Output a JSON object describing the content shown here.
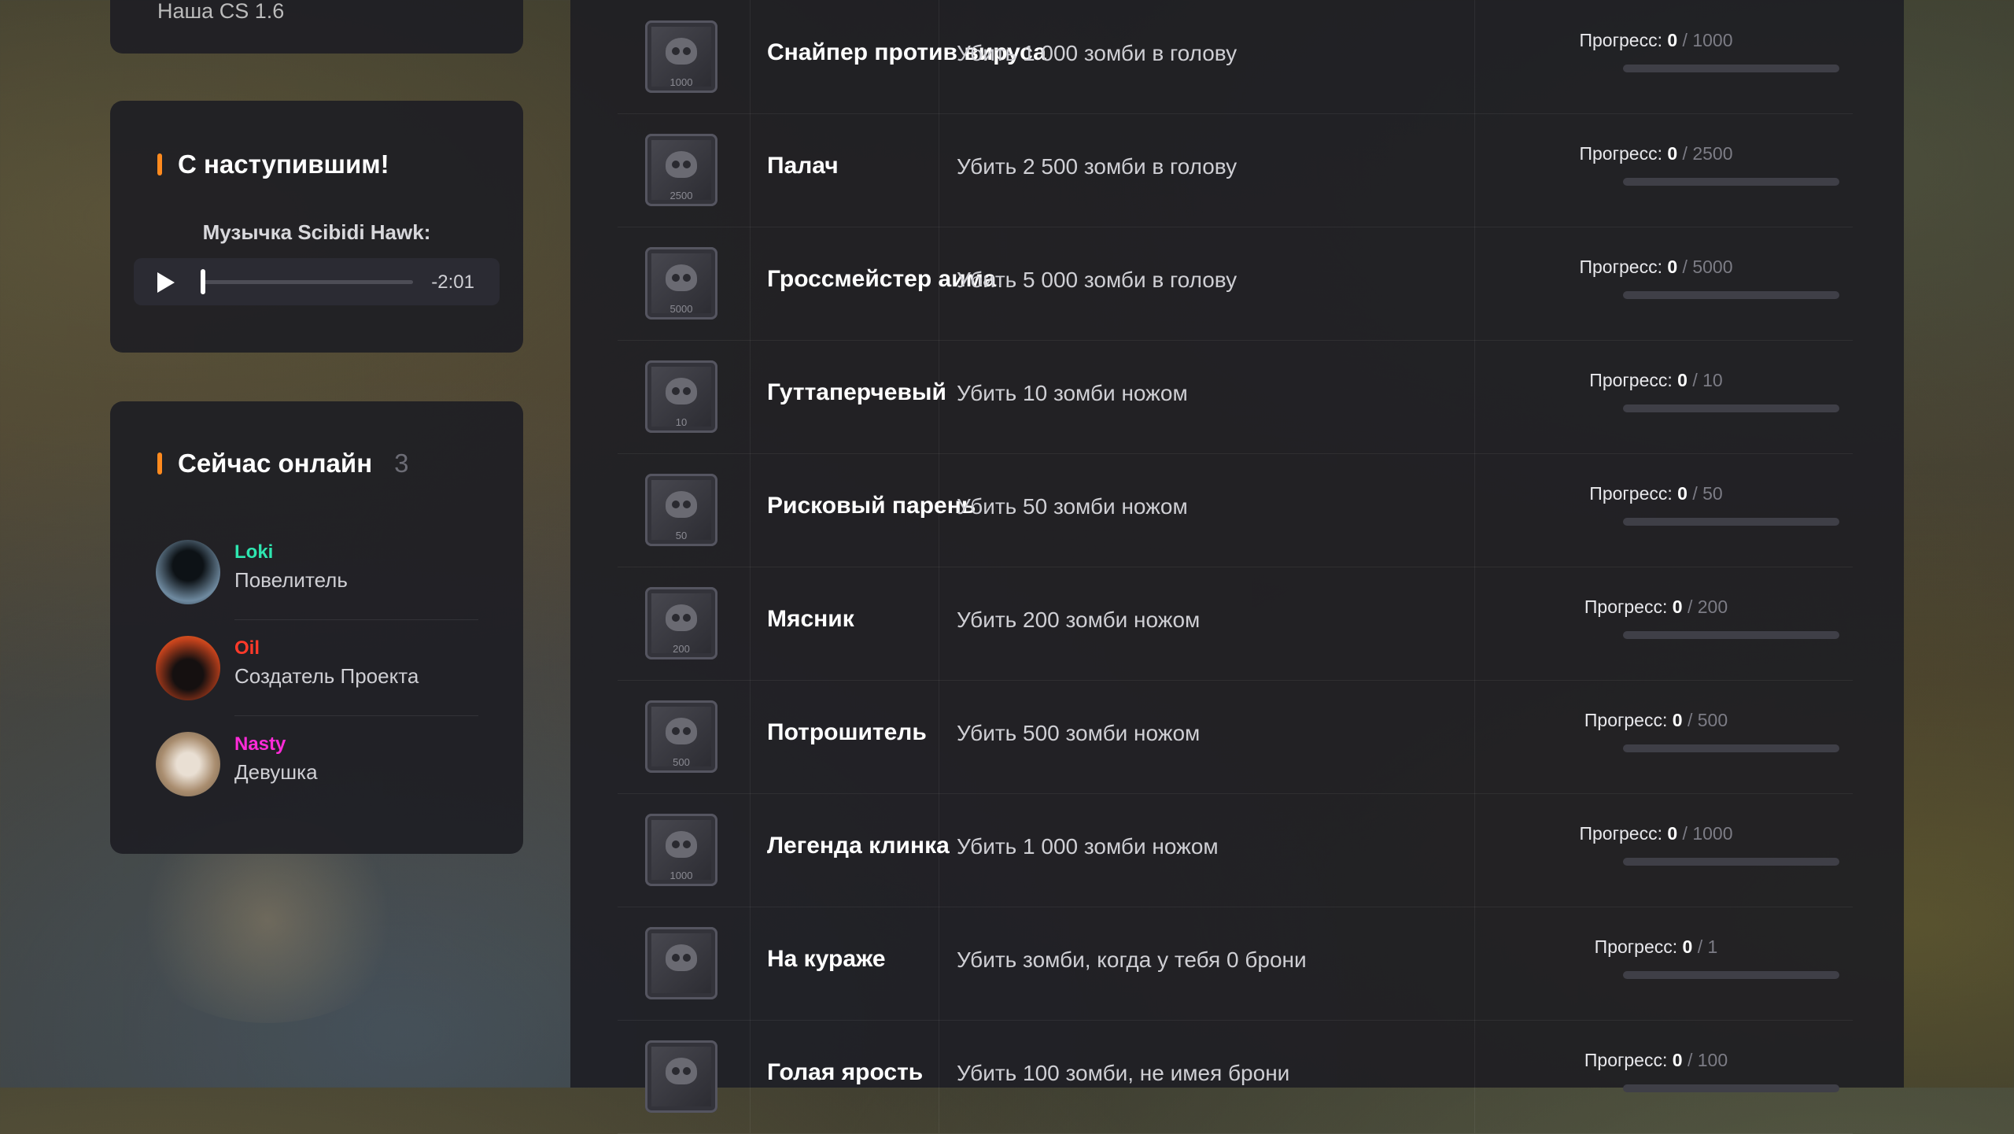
{
  "sidebar": {
    "top_card_title": "Наша CS 1.6",
    "music": {
      "title": "С наступившим!",
      "label": "Музычка Scibidi Hawk:",
      "time": "-2:01"
    },
    "online": {
      "title": "Сейчас онлайн",
      "count": "3",
      "users": [
        {
          "name": "Loki",
          "role": "Повелитель",
          "name_color": "#2ee6b0"
        },
        {
          "name": "Oil",
          "role": "Создатель Проекта",
          "name_color": "#ff3a2a"
        },
        {
          "name": "Nasty",
          "role": "Девушка",
          "name_color": "#ff2bd8"
        }
      ]
    }
  },
  "achievements": [
    {
      "title": "Снайпер против вируса",
      "desc": "Убить 1 000 зомби в голову",
      "progress_label": "Прогресс:",
      "current": "0",
      "sep": "/",
      "total": "1000",
      "fraction": 0
    },
    {
      "title": "Палач",
      "desc": "Убить 2 500 зомби в голову",
      "progress_label": "Прогресс:",
      "current": "0",
      "sep": "/",
      "total": "2500",
      "fraction": 0
    },
    {
      "title": "Гроссмейстер аима",
      "desc": "Убить 5 000 зомби в голову",
      "progress_label": "Прогресс:",
      "current": "0",
      "sep": "/",
      "total": "5000",
      "fraction": 0
    },
    {
      "title": "Гуттаперчевый",
      "desc": "Убить 10 зомби ножом",
      "progress_label": "Прогресс:",
      "current": "0",
      "sep": "/",
      "total": "10",
      "fraction": 0
    },
    {
      "title": "Рисковый парень",
      "desc": "Убить 50 зомби ножом",
      "progress_label": "Прогресс:",
      "current": "0",
      "sep": "/",
      "total": "50",
      "fraction": 0
    },
    {
      "title": "Мясник",
      "desc": "Убить 200 зомби ножом",
      "progress_label": "Прогресс:",
      "current": "0",
      "sep": "/",
      "total": "200",
      "fraction": 0
    },
    {
      "title": "Потрошитель",
      "desc": "Убить 500 зомби ножом",
      "progress_label": "Прогресс:",
      "current": "0",
      "sep": "/",
      "total": "500",
      "fraction": 0
    },
    {
      "title": "Легенда клинка",
      "desc": "Убить 1 000 зомби ножом",
      "progress_label": "Прогресс:",
      "current": "0",
      "sep": "/",
      "total": "1000",
      "fraction": 0
    },
    {
      "title": "На кураже",
      "desc": "Убить зомби, когда у тебя 0 брони",
      "progress_label": "Прогресс:",
      "current": "0",
      "sep": "/",
      "total": "1",
      "fraction": 0
    },
    {
      "title": "Голая ярость",
      "desc": "Убить 100 зомби, не имея брони",
      "progress_label": "Прогресс:",
      "current": "0",
      "sep": "/",
      "total": "100",
      "fraction": 0
    }
  ],
  "badge_numbers": [
    "1000",
    "2500",
    "5000",
    "10",
    "50",
    "200",
    "500",
    "1000",
    "",
    ""
  ],
  "colors": {
    "accent": "#ff8a1e"
  }
}
